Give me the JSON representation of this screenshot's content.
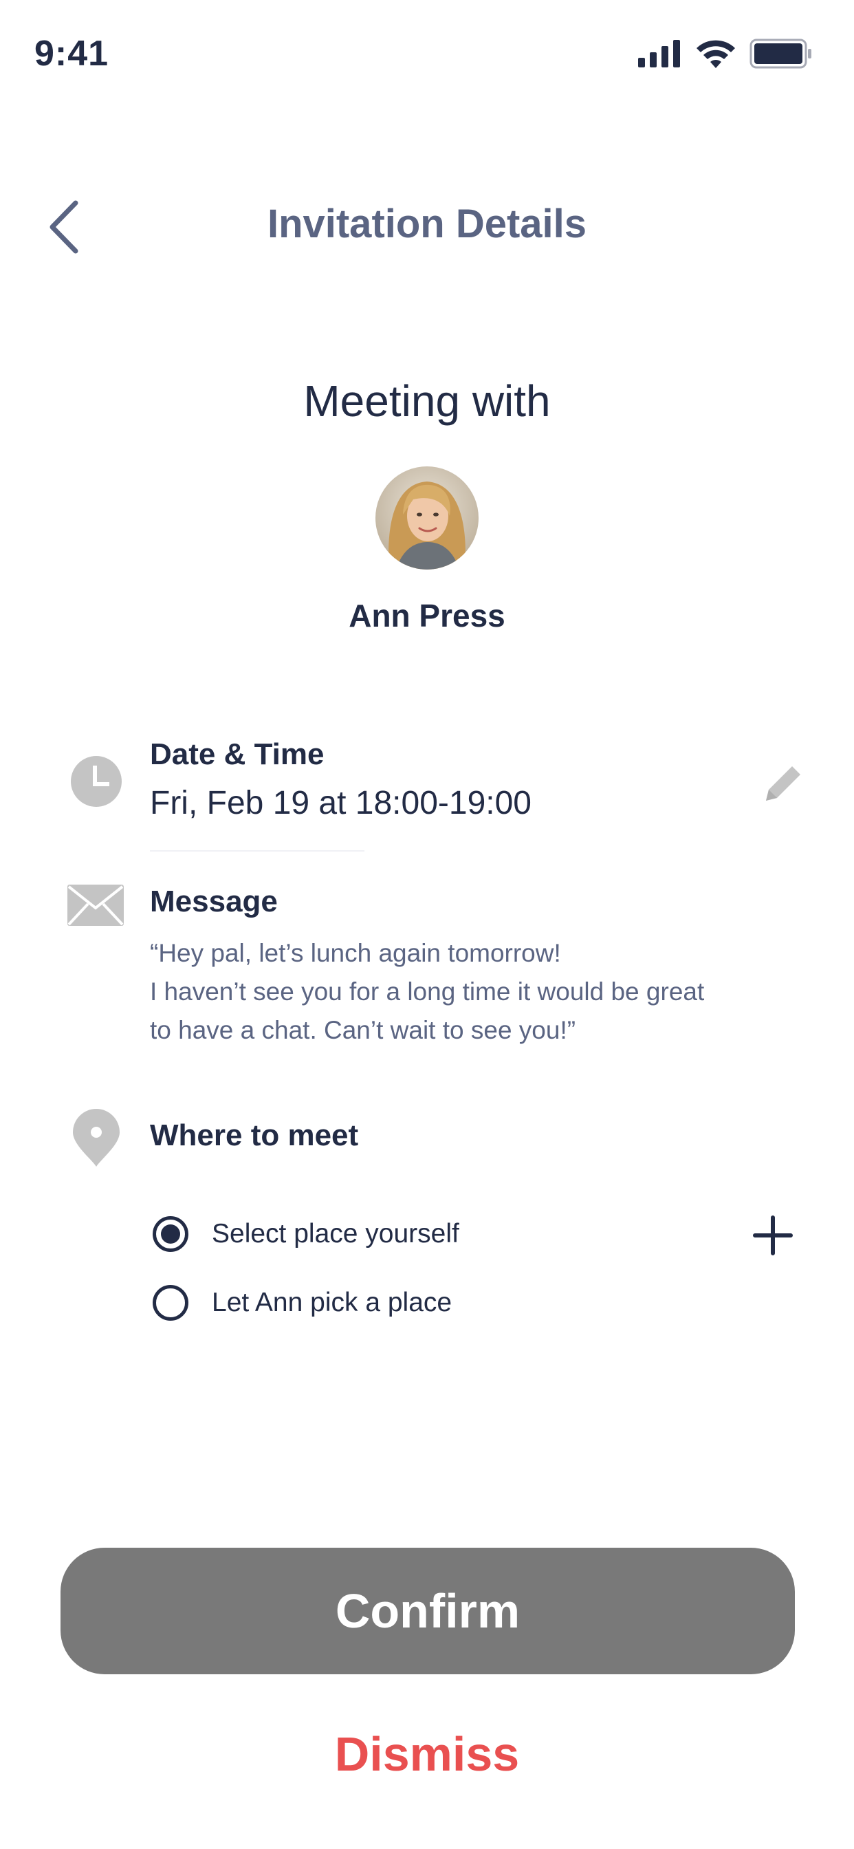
{
  "status_bar": {
    "time": "9:41",
    "icons": [
      "cellular-signal-icon",
      "wifi-icon",
      "battery-icon"
    ]
  },
  "header": {
    "back_icon": "chevron-left-icon",
    "title": "Invitation Details"
  },
  "invitation": {
    "heading": "Meeting with",
    "person_name": "Ann Press",
    "avatar_icon": "avatar-photo"
  },
  "date_time": {
    "icon": "clock-icon",
    "label": "Date & Time",
    "value": "Fri, Feb 19 at 18:00-19:00",
    "edit_icon": "pencil-icon"
  },
  "message": {
    "icon": "envelope-icon",
    "label": "Message",
    "lines": [
      "“Hey pal, let’s lunch again tomorrow!",
      "I haven’t see you for a long time it would be great",
      "to have a chat. Can’t wait to see you!”"
    ]
  },
  "location": {
    "icon": "map-pin-icon",
    "label": "Where to meet",
    "options": [
      {
        "label": "Select place yourself",
        "selected": true
      },
      {
        "label": "Let Ann pick a place",
        "selected": false
      }
    ],
    "add_icon": "plus-icon"
  },
  "actions": {
    "confirm_label": "Confirm",
    "dismiss_label": "Dismiss"
  },
  "colors": {
    "title": "#5a6482",
    "text": "#222b45",
    "confirm_bg": "#797979",
    "dismiss": "#e95050",
    "icon_gray": "#c4c4c4"
  }
}
